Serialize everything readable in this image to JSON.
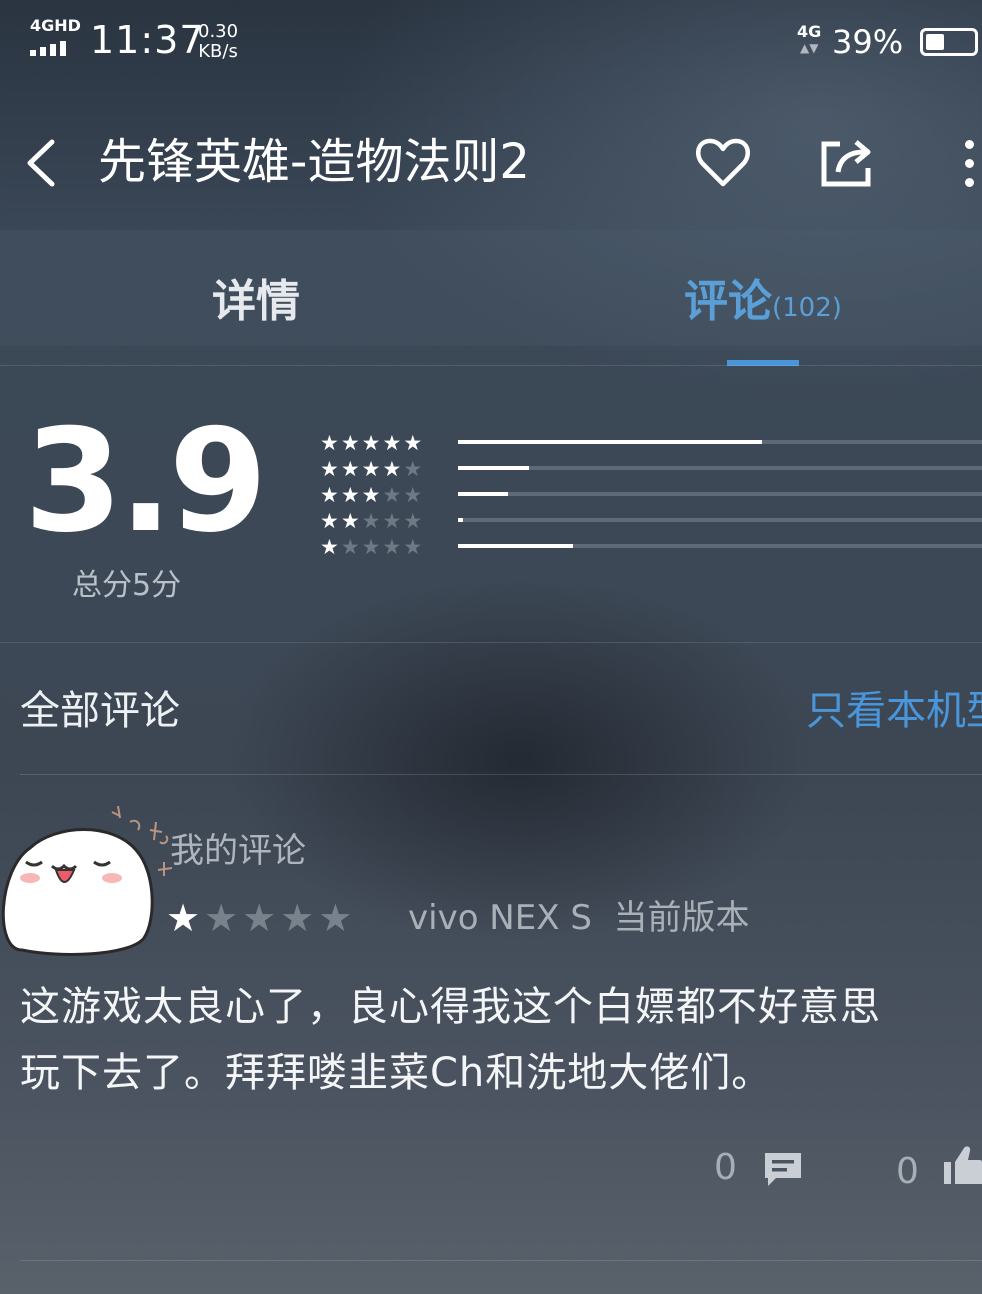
{
  "status_bar": {
    "network": "4GHD",
    "time": "11:37",
    "speed_value": "0.30",
    "speed_unit": "KB/s",
    "mobile_label": "4G",
    "battery_percent": "39%",
    "battery_level": 0.39
  },
  "header": {
    "title": "先锋英雄-造物法则2",
    "icons": [
      "back-icon",
      "heart-icon",
      "share-icon",
      "more-icon"
    ]
  },
  "tabs": {
    "details_label": "详情",
    "reviews_label": "评论",
    "reviews_count": "(102)",
    "active": "reviews",
    "active_color": "#4a94d8"
  },
  "rating": {
    "score": "3.9",
    "total_label": "总分5分",
    "distribution": [
      {
        "stars": 5,
        "fraction": 0.58
      },
      {
        "stars": 4,
        "fraction": 0.135
      },
      {
        "stars": 3,
        "fraction": 0.095
      },
      {
        "stars": 2,
        "fraction": 0.01
      },
      {
        "stars": 1,
        "fraction": 0.22
      }
    ]
  },
  "reviews_header": {
    "all_label": "全部评论",
    "filter_label": "只看本机型"
  },
  "review": {
    "author_label": "我的评论",
    "stars": 1,
    "device": "vivo NEX S",
    "version_label": "当前版本",
    "text_line1": "这游戏太良心了，良心得我这个白嫖都不好意思",
    "text_line2": "玩下去了。拜拜喽韭菜Ch和洗地大佬们。",
    "comment_count": "0",
    "like_count": "0"
  }
}
